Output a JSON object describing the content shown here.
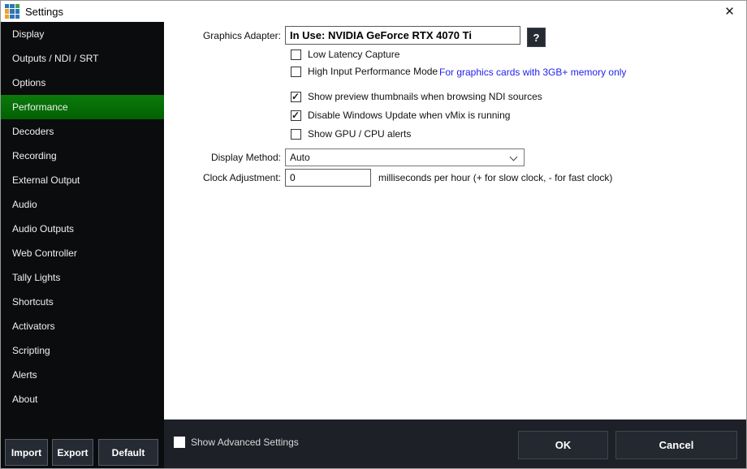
{
  "window": {
    "title": "Settings",
    "close_icon": "✕"
  },
  "colors": {
    "sidebar_bg": "#0b0c0e",
    "active_item_green": "#067306",
    "footer_bg": "#1d2026",
    "button_dark": "#262a33",
    "note_blue": "#2222ee",
    "logo_blue": "#2e75b6",
    "logo_green": "#43a047",
    "logo_orange": "#f0a030"
  },
  "sidebar": {
    "active_index": 3,
    "items": [
      {
        "label": "Display"
      },
      {
        "label": "Outputs / NDI / SRT"
      },
      {
        "label": "Options"
      },
      {
        "label": "Performance"
      },
      {
        "label": "Decoders"
      },
      {
        "label": "Recording"
      },
      {
        "label": "External Output"
      },
      {
        "label": "Audio"
      },
      {
        "label": "Audio Outputs"
      },
      {
        "label": "Web Controller"
      },
      {
        "label": "Tally Lights"
      },
      {
        "label": "Shortcuts"
      },
      {
        "label": "Activators"
      },
      {
        "label": "Scripting"
      },
      {
        "label": "Alerts"
      },
      {
        "label": "About"
      }
    ],
    "buttons": {
      "import": "Import",
      "export": "Export",
      "default": "Default"
    }
  },
  "content": {
    "graphics_adapter": {
      "label": "Graphics Adapter:",
      "value": "In Use: NVIDIA GeForce RTX 4070 Ti",
      "help_button": "?"
    },
    "checkboxes": [
      {
        "label": "Low Latency Capture",
        "checked": false
      },
      {
        "label": "High Input Performance Mode",
        "checked": false
      },
      {
        "label": "Show preview thumbnails when browsing NDI sources",
        "checked": true
      },
      {
        "label": "Disable Windows Update when vMix is running",
        "checked": true
      },
      {
        "label": "Show GPU / CPU alerts",
        "checked": false
      }
    ],
    "high_input_note": "For graphics cards with 3GB+ memory only",
    "display_method": {
      "label": "Display Method:",
      "value": "Auto"
    },
    "clock_adjustment": {
      "label": "Clock Adjustment:",
      "value": "0",
      "hint": "milliseconds per hour (+ for slow clock, - for fast clock)"
    }
  },
  "footer": {
    "advanced": {
      "label": "Show Advanced Settings",
      "checked": false
    },
    "ok_label": "OK",
    "cancel_label": "Cancel"
  }
}
